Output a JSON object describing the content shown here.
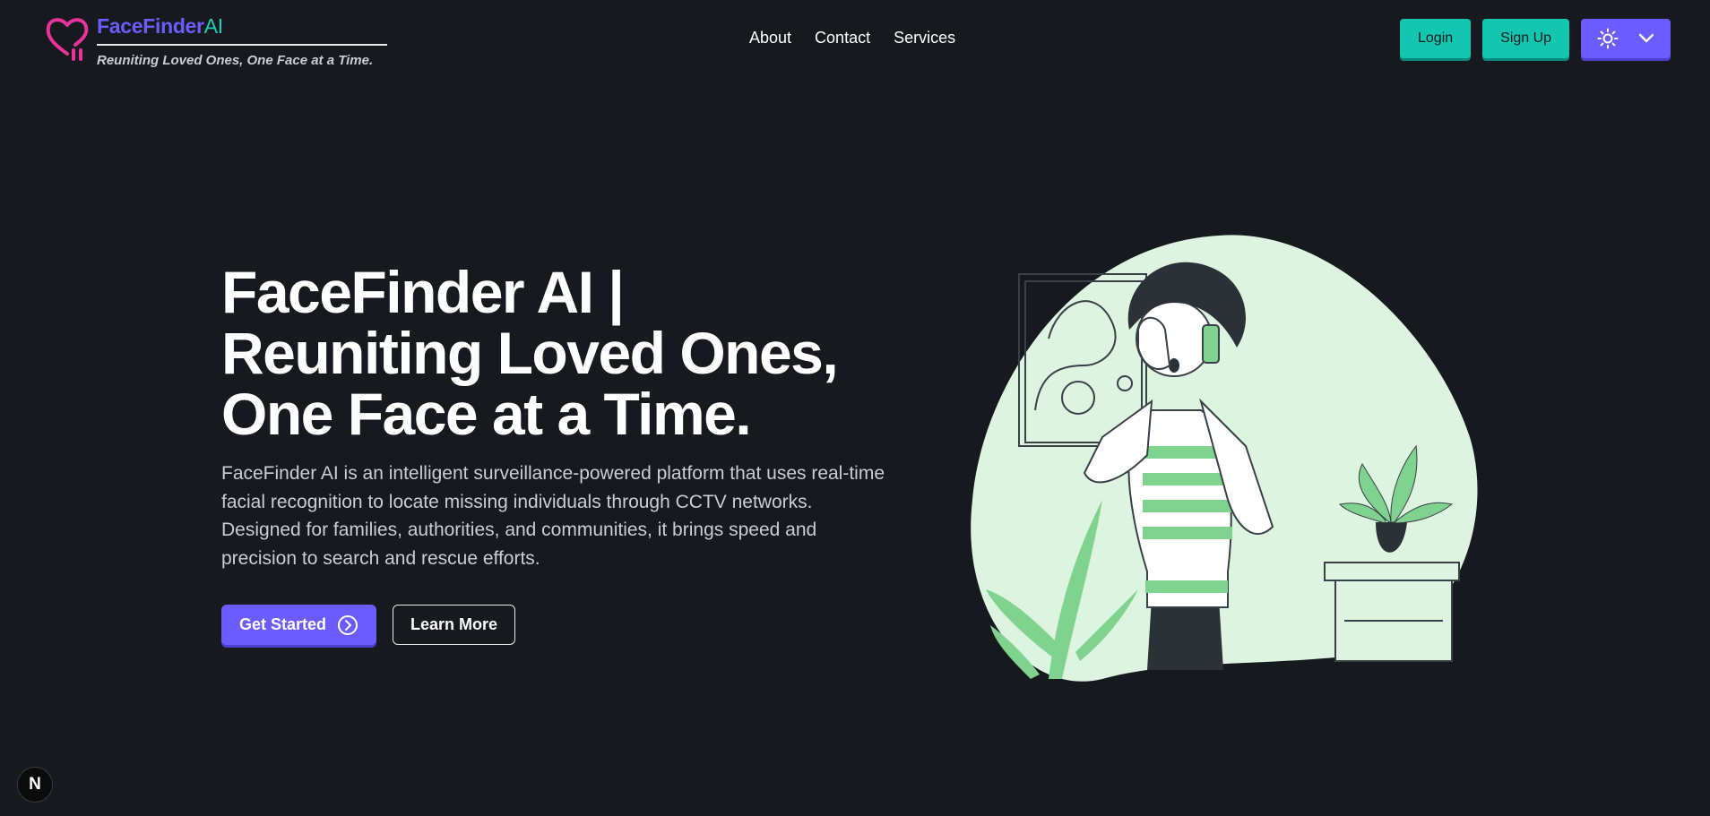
{
  "brand": {
    "name_part1": "FaceFinder",
    "name_part2": "AI",
    "tagline": "Reuniting Loved Ones, One Face at a Time.",
    "logo_icon": "heart-pulse-icon",
    "colors": {
      "primary": "#6b5cff",
      "teal": "#13c6b0",
      "pink": "#e8339b",
      "background": "#16191e"
    }
  },
  "nav": {
    "items": [
      "About",
      "Contact",
      "Services"
    ]
  },
  "actions": {
    "login_label": "Login",
    "signup_label": "Sign Up",
    "theme_icon": "sun-icon",
    "theme_dropdown_icon": "chevron-down-icon"
  },
  "hero": {
    "title_line1": "FaceFinder AI |",
    "title_line2": "Reuniting Loved Ones,",
    "title_line3": "One Face at a Time.",
    "description_line1": "FaceFinder AI is an intelligent surveillance-powered platform that uses real-time",
    "description_line2": "facial recognition to locate missing individuals through CCTV networks.",
    "description_line3": "Designed for families, authorities, and communities, it brings speed and",
    "description_line4": "precision to search and rescue efforts.",
    "get_started_label": "Get Started",
    "learn_more_label": "Learn More"
  },
  "badge": {
    "letter": "N"
  }
}
